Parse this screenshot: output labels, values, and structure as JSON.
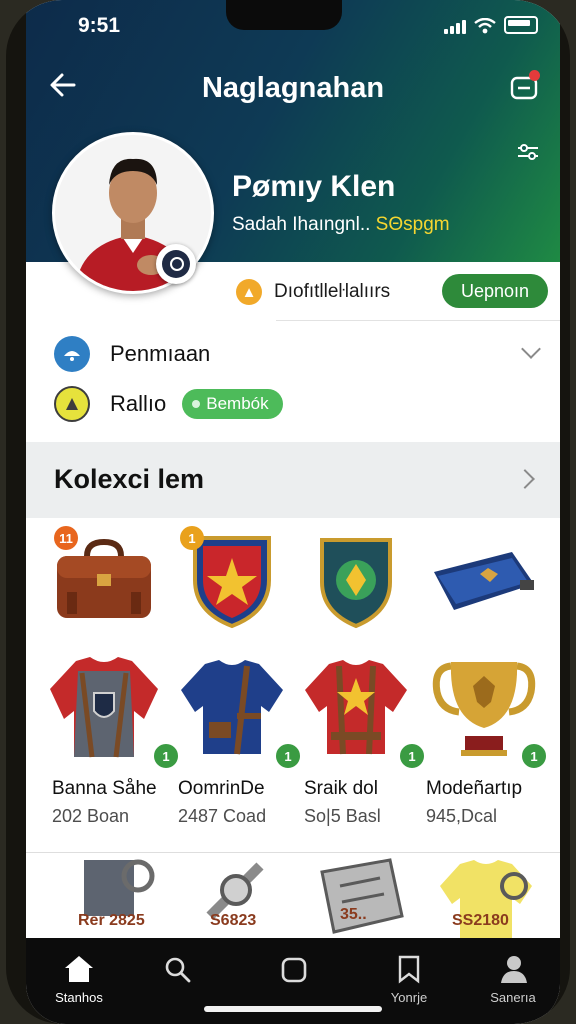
{
  "status": {
    "time": "9:51"
  },
  "header": {
    "title": "Naglagnahan"
  },
  "profile": {
    "name": "Pømıy Klen",
    "subtitle": "Sadah Ihaıngnl..",
    "subtitle_highlight": "SΘspgm"
  },
  "stat": {
    "label": "Dıofıtlleŀlalıırs",
    "button_label": "Uepnoın"
  },
  "menu": {
    "row1_label": "Penmıaan",
    "row2_label": "Rallıo",
    "row2_pill": "Bembók"
  },
  "collection": {
    "title": "Kolexci lem",
    "rank_badges": [
      "11",
      "1"
    ],
    "owned_badge": "1",
    "items": [
      {
        "name": "Banna Såhe",
        "price": "202 Boan"
      },
      {
        "name": "OomrinDe",
        "price": "2487 Coad"
      },
      {
        "name": "Sraik dol",
        "price": "So|5 Basl"
      },
      {
        "name": "Modeñartıp",
        "price": "945,Dcal"
      }
    ],
    "bottom_labels": [
      "Rer 2825",
      "S6823",
      "35..",
      "SS2180"
    ]
  },
  "nav": {
    "items": [
      {
        "label": "Stanhos",
        "icon": "home-icon"
      },
      {
        "label": "",
        "icon": "search-icon"
      },
      {
        "label": "",
        "icon": "square-icon"
      },
      {
        "label": "Yonrje",
        "icon": "bookmark-icon"
      },
      {
        "label": "Sanerıa",
        "icon": "profile-icon"
      }
    ]
  },
  "colors": {
    "accent_green": "#2e8a3a",
    "header_start": "#0d2b4a",
    "header_end": "#1f8a44",
    "highlight_yellow": "#f5d630"
  }
}
